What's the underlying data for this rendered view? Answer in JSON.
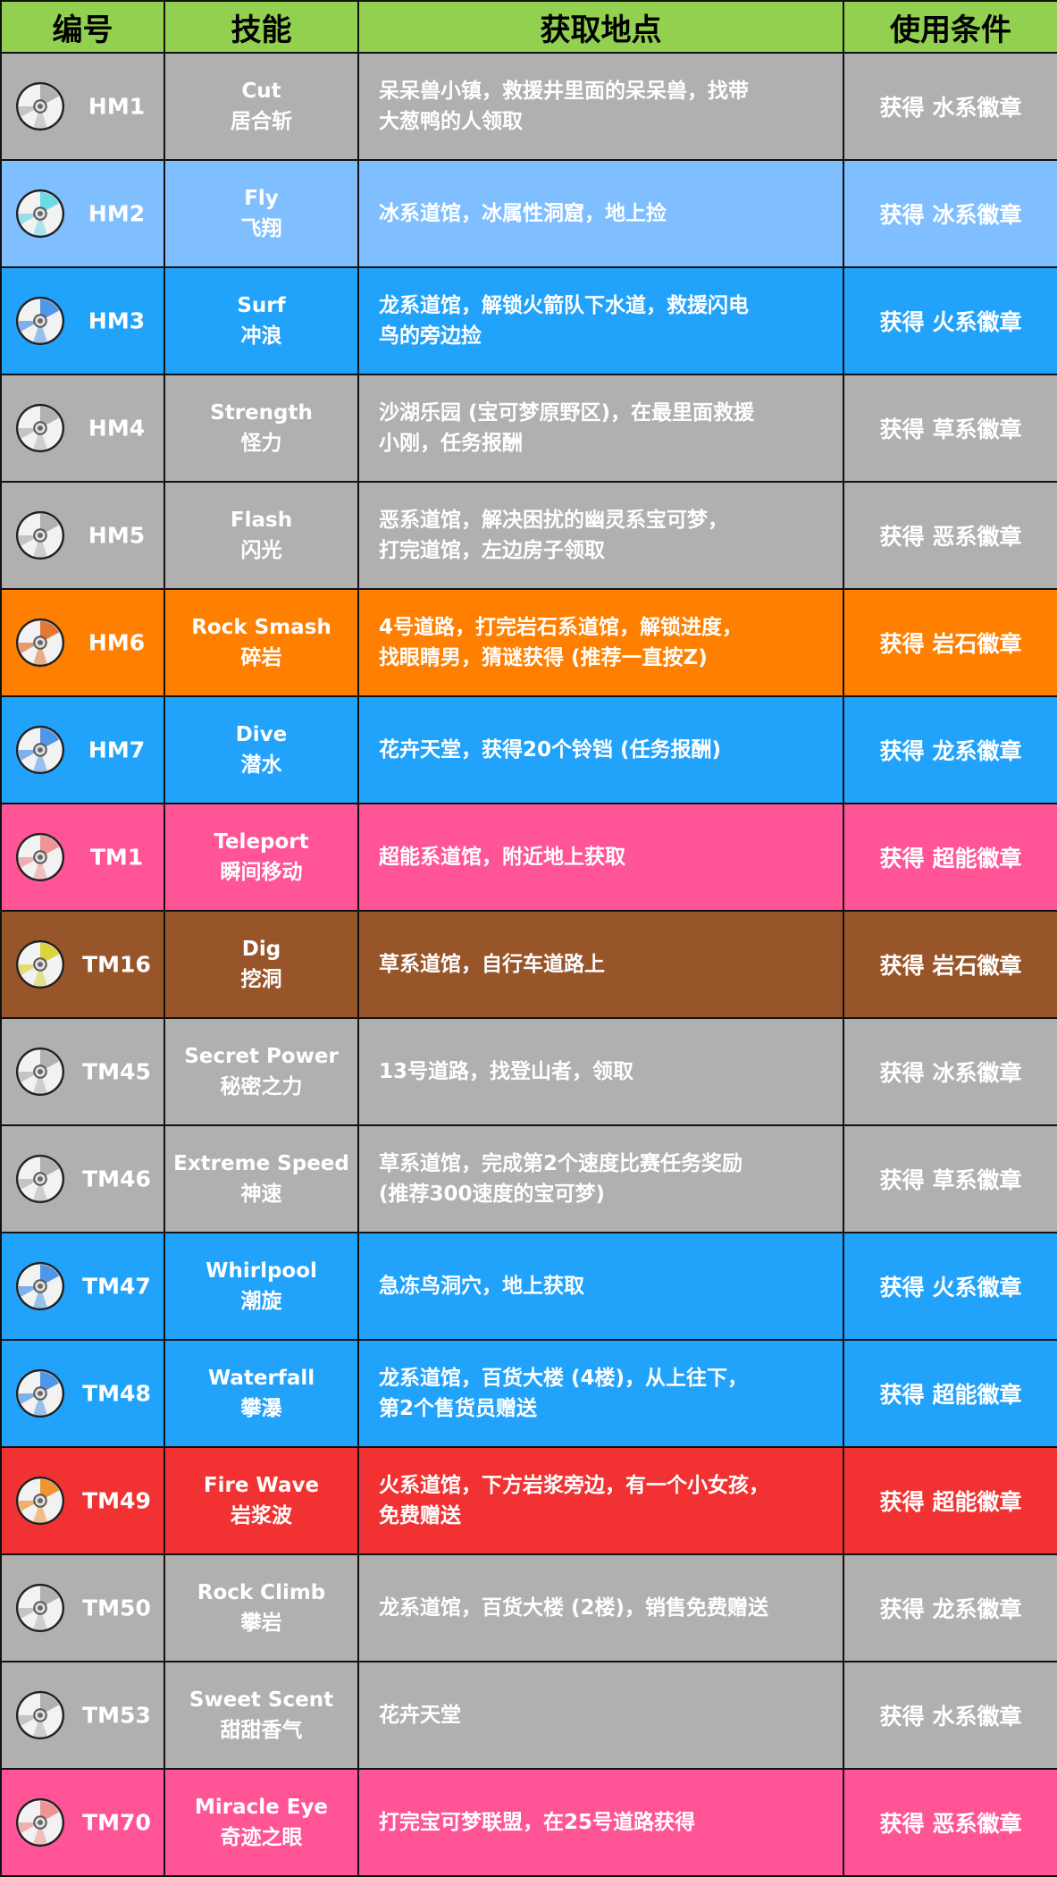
{
  "headers": {
    "number": "编号",
    "skill": "技能",
    "location": "获取地点",
    "condition": "使用条件"
  },
  "condition_prefix": "获得",
  "icon": "cd-disc-icon",
  "rows": [
    {
      "number": "HM1",
      "skill_en": "Cut",
      "skill_zh": "居合斩",
      "location_lines": [
        "呆呆兽小镇，救援井里面的呆呆兽，找带",
        "大葱鸭的人领取"
      ],
      "badge": "水系徽章",
      "row_color": "#b0b0b0",
      "disc_color": "#aaaaaa"
    },
    {
      "number": "HM2",
      "skill_en": "Fly",
      "skill_zh": "飞翔",
      "location_lines": [
        "冰系道馆，冰属性洞窟，地上捡"
      ],
      "badge": "冰系徽章",
      "row_color": "#7fbfff",
      "disc_color": "#5fd6e6"
    },
    {
      "number": "HM3",
      "skill_en": "Surf",
      "skill_zh": "冲浪",
      "location_lines": [
        "龙系道馆，解锁火箭队下水道，救援闪电",
        "鸟的旁边捡"
      ],
      "badge": "火系徽章",
      "row_color": "#22a3fb",
      "disc_color": "#3d8ee8"
    },
    {
      "number": "HM4",
      "skill_en": "Strength",
      "skill_zh": "怪力",
      "location_lines": [
        "沙湖乐园 (宝可梦原野区)，在最里面救援",
        "小刚，任务报酬"
      ],
      "badge": "草系徽章",
      "row_color": "#b0b0b0",
      "disc_color": "#aaaaaa"
    },
    {
      "number": "HM5",
      "skill_en": "Flash",
      "skill_zh": "闪光",
      "location_lines": [
        "恶系道馆，解决困扰的幽灵系宝可梦，",
        "打完道馆，左边房子领取"
      ],
      "badge": "恶系徽章",
      "row_color": "#b0b0b0",
      "disc_color": "#aaaaaa"
    },
    {
      "number": "HM6",
      "skill_en": "Rock Smash",
      "skill_zh": "碎岩",
      "location_lines": [
        "4号道路，打完岩石系道馆，解锁进度，",
        "找眼睛男，猜谜获得 (推荐一直按Z)"
      ],
      "badge": "岩石徽章",
      "row_color": "#ff7f00",
      "disc_color": "#e06a20"
    },
    {
      "number": "HM7",
      "skill_en": "Dive",
      "skill_zh": "潜水",
      "location_lines": [
        "花卉天堂，获得20个铃铛 (任务报酬)"
      ],
      "badge": "龙系徽章",
      "row_color": "#22a3fb",
      "disc_color": "#3d8ee8"
    },
    {
      "number": "TM1",
      "skill_en": "Teleport",
      "skill_zh": "瞬间移动",
      "location_lines": [
        "超能系道馆，附近地上获取"
      ],
      "badge": "超能徽章",
      "row_color": "#ff5496",
      "disc_color": "#ee8a8a"
    },
    {
      "number": "TM16",
      "skill_en": "Dig",
      "skill_zh": "挖洞",
      "location_lines": [
        "草系道馆，自行车道路上"
      ],
      "badge": "岩石徽章",
      "row_color": "#99552a",
      "disc_color": "#d6d02a"
    },
    {
      "number": "TM45",
      "skill_en": "Secret Power",
      "skill_zh": "秘密之力",
      "location_lines": [
        "13号道路，找登山者，领取"
      ],
      "badge": "冰系徽章",
      "row_color": "#b0b0b0",
      "disc_color": "#aaaaaa"
    },
    {
      "number": "TM46",
      "skill_en": "Extreme Speed",
      "skill_zh": "神速",
      "location_lines": [
        "草系道馆，完成第2个速度比赛任务奖励",
        "(推荐300速度的宝可梦)"
      ],
      "badge": "草系徽章",
      "row_color": "#b0b0b0",
      "disc_color": "#aaaaaa"
    },
    {
      "number": "TM47",
      "skill_en": "Whirlpool",
      "skill_zh": "潮旋",
      "location_lines": [
        "急冻鸟洞穴，地上获取"
      ],
      "badge": "火系徽章",
      "row_color": "#22a3fb",
      "disc_color": "#3d8ee8"
    },
    {
      "number": "TM48",
      "skill_en": "Waterfall",
      "skill_zh": "攀瀑",
      "location_lines": [
        "龙系道馆，百货大楼 (4楼)，从上往下，",
        "第2个售货员赠送"
      ],
      "badge": "超能徽章",
      "row_color": "#22a3fb",
      "disc_color": "#3d8ee8"
    },
    {
      "number": "TM49",
      "skill_en": "Fire Wave",
      "skill_zh": "岩浆波",
      "location_lines": [
        "火系道馆，下方岩浆旁边，有一个小女孩，",
        "免费赠送"
      ],
      "badge": "超能徽章",
      "row_color": "#f23232",
      "disc_color": "#f08a1c"
    },
    {
      "number": "TM50",
      "skill_en": "Rock Climb",
      "skill_zh": "攀岩",
      "location_lines": [
        "龙系道馆，百货大楼 (2楼)，销售免费赠送"
      ],
      "badge": "龙系徽章",
      "row_color": "#b0b0b0",
      "disc_color": "#aaaaaa"
    },
    {
      "number": "TM53",
      "skill_en": "Sweet Scent",
      "skill_zh": "甜甜香气",
      "location_lines": [
        "花卉天堂"
      ],
      "badge": "水系徽章",
      "row_color": "#b0b0b0",
      "disc_color": "#aaaaaa"
    },
    {
      "number": "TM70",
      "skill_en": "Miracle Eye",
      "skill_zh": "奇迹之眼",
      "location_lines": [
        "打完宝可梦联盟，在25号道路获得"
      ],
      "badge": "恶系徽章",
      "row_color": "#ff5496",
      "disc_color": "#ee8a8a"
    }
  ]
}
